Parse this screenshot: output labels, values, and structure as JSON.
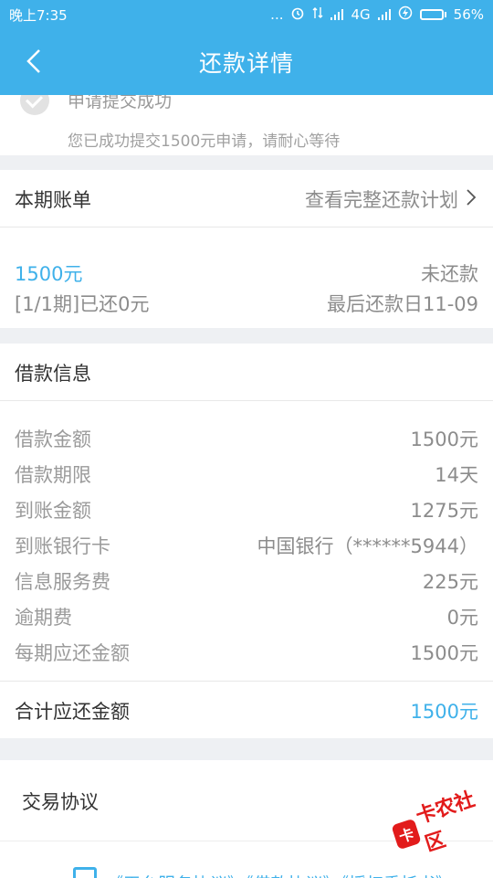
{
  "status_bar": {
    "time": "晚上7:35",
    "dots": "...",
    "network": "4G",
    "battery": "56%",
    "battery_level": 0.56
  },
  "nav": {
    "title": "还款详情",
    "back_icon": "chevron-left-icon"
  },
  "notice": {
    "title_partial": "申请提交成功",
    "message": "您已成功提交1500元申请，请耐心等待"
  },
  "bill": {
    "header": "本期账单",
    "view_plan": "查看完整还款计划",
    "amount": "1500元",
    "status": "未还款",
    "period_info": "[1/1期]已还0元",
    "due_date": "最后还款日11-09"
  },
  "loan_info": {
    "header": "借款信息",
    "rows": [
      {
        "label": "借款金额",
        "value": "1500元"
      },
      {
        "label": "借款期限",
        "value": "14天"
      },
      {
        "label": "到账金额",
        "value": "1275元"
      },
      {
        "label": "到账银行卡",
        "value": "中国银行（******5944）"
      },
      {
        "label": "信息服务费",
        "value": "225元"
      },
      {
        "label": "逾期费",
        "value": "0元"
      },
      {
        "label": "每期应还金额",
        "value": "1500元"
      }
    ],
    "total_label": "合计应还金额",
    "total_value": "1500元"
  },
  "agreement": {
    "header": "交易协议",
    "links_partial": "《平台服务协议》《借款协议》《授权委托书》"
  },
  "watermark": {
    "text": "卡农社区",
    "logo": "卡"
  },
  "colors": {
    "accent": "#3fb1ea",
    "battery_fill": "#7CFC4A",
    "watermark": "#e21b1b"
  }
}
